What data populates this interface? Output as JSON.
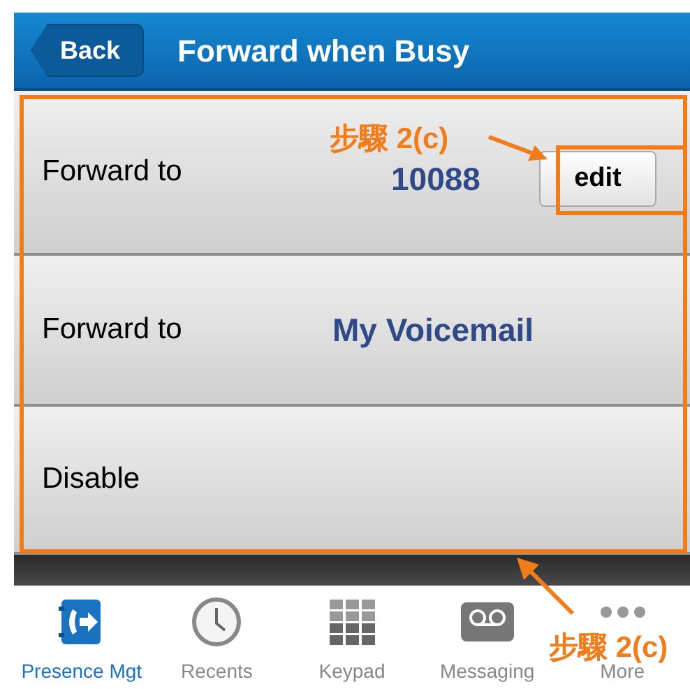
{
  "nav": {
    "back": "Back",
    "title": "Forward when Busy"
  },
  "rows": [
    {
      "kind": "edit",
      "label": "Forward to",
      "value": "10088",
      "button": "edit"
    },
    {
      "kind": "value",
      "label": "Forward to",
      "value": "My Voicemail"
    },
    {
      "kind": "plain",
      "label": "Disable"
    }
  ],
  "tabs": [
    {
      "kind": "presence",
      "label": "Presence Mgt",
      "selected": true
    },
    {
      "kind": "recents",
      "label": "Recents",
      "selected": false
    },
    {
      "kind": "keypad",
      "label": "Keypad",
      "selected": false
    },
    {
      "kind": "messaging",
      "label": "Messaging",
      "selected": false
    },
    {
      "kind": "more",
      "label": "More",
      "selected": false
    }
  ],
  "annotations": [
    {
      "text": "步驟 2(c)"
    },
    {
      "text": "步驟 2(c)"
    }
  ]
}
